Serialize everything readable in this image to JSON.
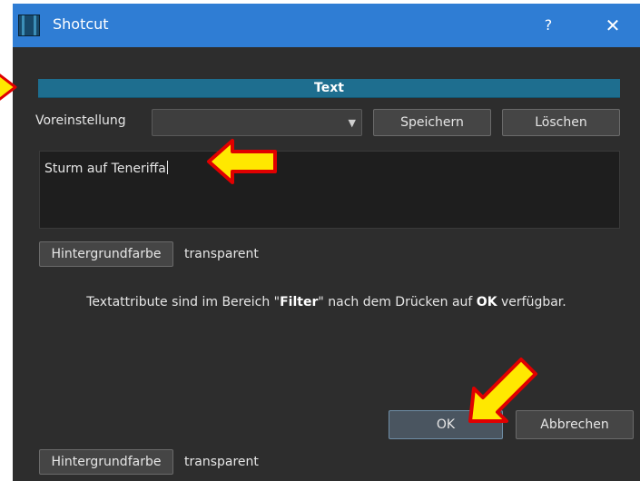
{
  "window": {
    "title": "Shotcut",
    "help_label": "?",
    "close_label": "✕",
    "titlebar_color": "#2f7dd4",
    "icons": {
      "app": "shotcut-app-icon",
      "help": "help-icon",
      "close": "close-icon"
    }
  },
  "text_panel": {
    "header": "Text",
    "preset_label": "Voreinstellung",
    "preset_value": "",
    "preset_arrow": "▼",
    "save_label": "Speichern",
    "delete_label": "Löschen",
    "text_value": "Sturm auf Teneriffa",
    "bg_button_label": "Hintergrundfarbe",
    "bg_value": "transparent",
    "info": {
      "part1": "Textattribute sind im Bereich \"",
      "bold1": "Filter",
      "part2": "\" nach dem Drücken auf ",
      "bold2": "OK",
      "part3": " verfügbar."
    }
  },
  "dialog_buttons": {
    "ok_label": "OK",
    "cancel_label": "Abbrechen"
  },
  "footer": {
    "bg_button_label": "Hintergrundfarbe",
    "bg_value": "transparent"
  },
  "annotations": {
    "arrow_color": "#ffe800",
    "arrow_outline": "#e00000"
  }
}
